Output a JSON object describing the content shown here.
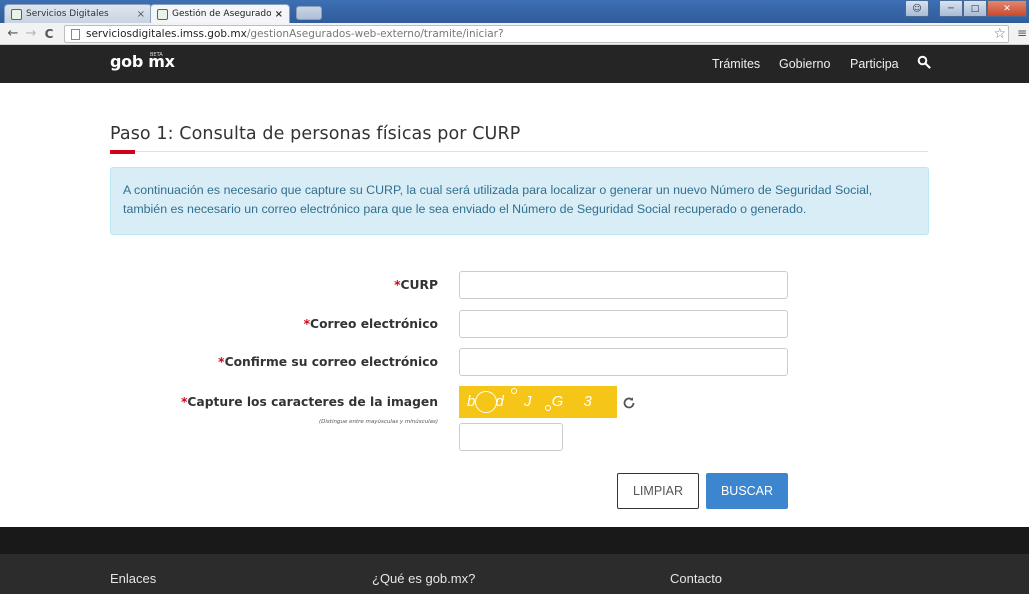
{
  "browser": {
    "tabs": [
      {
        "label": "Servicios Digitales",
        "close": "×"
      },
      {
        "label": "Gestión de Asegurados - F",
        "close": "×"
      }
    ],
    "url": {
      "host": "serviciosdigitales.imss.gob.mx",
      "path": "/gestionAsegurados-web-externo/tramite/iniciar?"
    },
    "nav": {
      "back": "←",
      "forward": "→",
      "reload": "C"
    }
  },
  "header": {
    "logo": "gob mx",
    "logo_badge": "BETA",
    "nav": [
      "Trámites",
      "Gobierno",
      "Participa"
    ]
  },
  "main": {
    "title": "Paso 1: Consulta de personas físicas por CURP",
    "info": "A continuación es necesario que capture su CURP, la cual será utilizada para localizar o generar un nuevo Número de Seguridad Social, también es necesario un correo electrónico para que le sea enviado el Número de Seguridad Social recuperado o generado."
  },
  "form": {
    "required_mark": "*",
    "curp_label": "CURP",
    "email_label": "Correo electrónico",
    "confirm_label": "Confirme su correo electrónico",
    "captcha_label": "Capture los caracteres de la imagen",
    "captcha_hint": "(Distingue entre mayúsculas y minúsculas)",
    "captcha_text": "b d J G 3",
    "clear_button": "LIMPIAR",
    "search_button": "BUSCAR"
  },
  "footer": {
    "links_title": "Enlaces",
    "about_title": "¿Qué es gob.mx?",
    "contact_title": "Contacto"
  },
  "colors": {
    "accent_red": "#d0021b",
    "primary_blue": "#3b86cf",
    "captcha_yellow": "#f5c518",
    "header_dark": "#252525"
  }
}
